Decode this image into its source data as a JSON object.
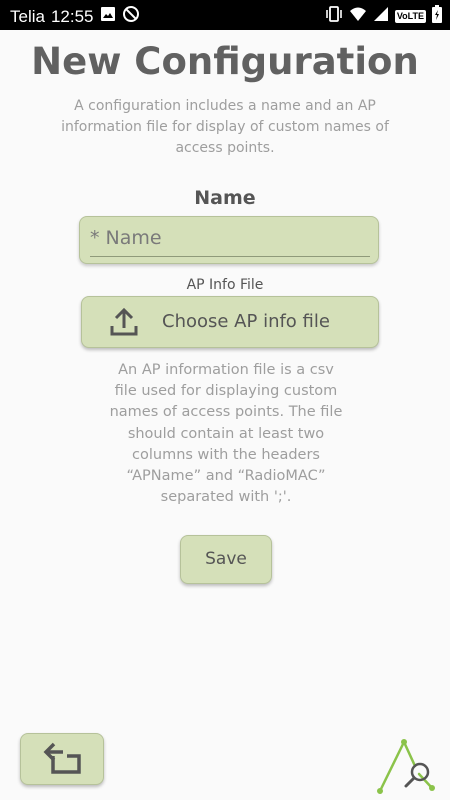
{
  "status_bar": {
    "carrier": "Telia",
    "time": "12:55",
    "volte": "VoLTE",
    "icons": [
      "image-icon",
      "sync-blocked-icon",
      "vibrate-icon",
      "wifi-icon",
      "signal-icon",
      "battery-icon"
    ]
  },
  "page": {
    "title": "New Configuration",
    "subtitle": "A configuration includes a name and an AP information file for display of custom names of access points."
  },
  "name_section": {
    "label": "Name",
    "placeholder": "* Name",
    "value": ""
  },
  "ap_info_section": {
    "label": "AP Info File",
    "button_label": "Choose AP info file",
    "button_icon": "upload-icon",
    "help_text": "An AP information file is a csv file used for displaying custom names of access points. The file should contain at least two columns with the headers “APName” and “RadioMAC” separated with ';'."
  },
  "actions": {
    "save_label": "Save",
    "back_icon": "back-icon"
  },
  "colors": {
    "button_bg": "#d5e0b9",
    "button_border": "#b6c29a",
    "title_text": "#616161",
    "muted_text": "#9e9e9e",
    "logo_green": "#8bc34a"
  }
}
